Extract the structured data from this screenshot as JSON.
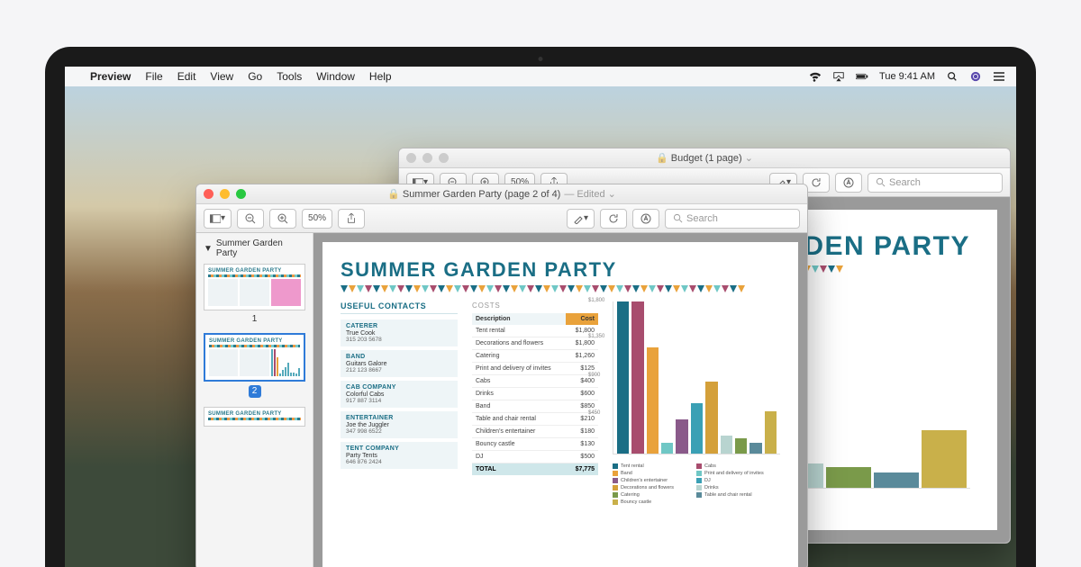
{
  "menubar": {
    "app": "Preview",
    "items": [
      "File",
      "Edit",
      "View",
      "Go",
      "Tools",
      "Window",
      "Help"
    ],
    "time": "Tue 9:41 AM"
  },
  "win_back": {
    "title": "Budget (1 page)",
    "zoom": "50%",
    "search_placeholder": "Search"
  },
  "win_front": {
    "title": "Summer Garden Party (page 2 of 4)",
    "edited": "— Edited",
    "zoom": "50%",
    "search_placeholder": "Search",
    "sidebar_title": "Summer Garden Party",
    "thumbs": [
      {
        "num": "1"
      },
      {
        "num": "2"
      }
    ]
  },
  "doc": {
    "title": "SUMMER GARDEN PARTY",
    "contacts_head": "USEFUL CONTACTS",
    "costs_head": "COSTS",
    "th1": "Description",
    "th2": "Cost",
    "total_label": "TOTAL",
    "total_val": "$7,775",
    "contacts": [
      {
        "role": "CATERER",
        "name": "True Cook",
        "phone": "315 203 5678"
      },
      {
        "role": "BAND",
        "name": "Guitars Galore",
        "phone": "212 123 8667"
      },
      {
        "role": "CAB COMPANY",
        "name": "Colorful Cabs",
        "phone": "917 887 3114"
      },
      {
        "role": "ENTERTAINER",
        "name": "Joe the Juggler",
        "phone": "347 998 6522"
      },
      {
        "role": "TENT COMPANY",
        "name": "Party Tents",
        "phone": "646 876 2424"
      }
    ],
    "costs": [
      {
        "d": "Tent rental",
        "c": "$1,800"
      },
      {
        "d": "Decorations and flowers",
        "c": "$1,800"
      },
      {
        "d": "Catering",
        "c": "$1,260"
      },
      {
        "d": "Print and delivery of invites",
        "c": "$125"
      },
      {
        "d": "Cabs",
        "c": "$400"
      },
      {
        "d": "Drinks",
        "c": "$600"
      },
      {
        "d": "Band",
        "c": "$850"
      },
      {
        "d": "Table and chair rental",
        "c": "$210"
      },
      {
        "d": "Children's entertainer",
        "c": "$180"
      },
      {
        "d": "Bouncy castle",
        "c": "$130"
      },
      {
        "d": "DJ",
        "c": "$500"
      }
    ]
  },
  "chart_data": {
    "type": "bar",
    "title": "",
    "ylabel": "",
    "xlabel": "",
    "ylim": [
      0,
      1800
    ],
    "yticks": [
      450,
      900,
      1350,
      1800
    ],
    "categories": [
      "Tent rental",
      "Decorations and flowers",
      "Catering",
      "Print and delivery of invites",
      "Cabs",
      "Drinks",
      "Band",
      "Table and chair rental",
      "Children's entertainer",
      "Bouncy castle",
      "DJ"
    ],
    "values": [
      1800,
      1800,
      1260,
      125,
      400,
      600,
      850,
      210,
      180,
      130,
      500
    ],
    "colors": [
      "#1a6e85",
      "#a84d6e",
      "#e9a23b",
      "#6fc7c5",
      "#8a5a8a",
      "#3aa0b5",
      "#d4a03a",
      "#b8d4d0",
      "#7a9a4a",
      "#5a8a9a",
      "#c9b04a"
    ],
    "legend": [
      "Tent rental",
      "Cabs",
      "Band",
      "Print and delivery of invites",
      "Children's entertainer",
      "DJ",
      "Decorations and flowers",
      "Drinks",
      "Catering",
      "Table and chair rental",
      "Bouncy castle"
    ]
  },
  "yticklabels": {
    "0": "$450",
    "1": "$900",
    "2": "$1,350",
    "3": "$1,800"
  }
}
